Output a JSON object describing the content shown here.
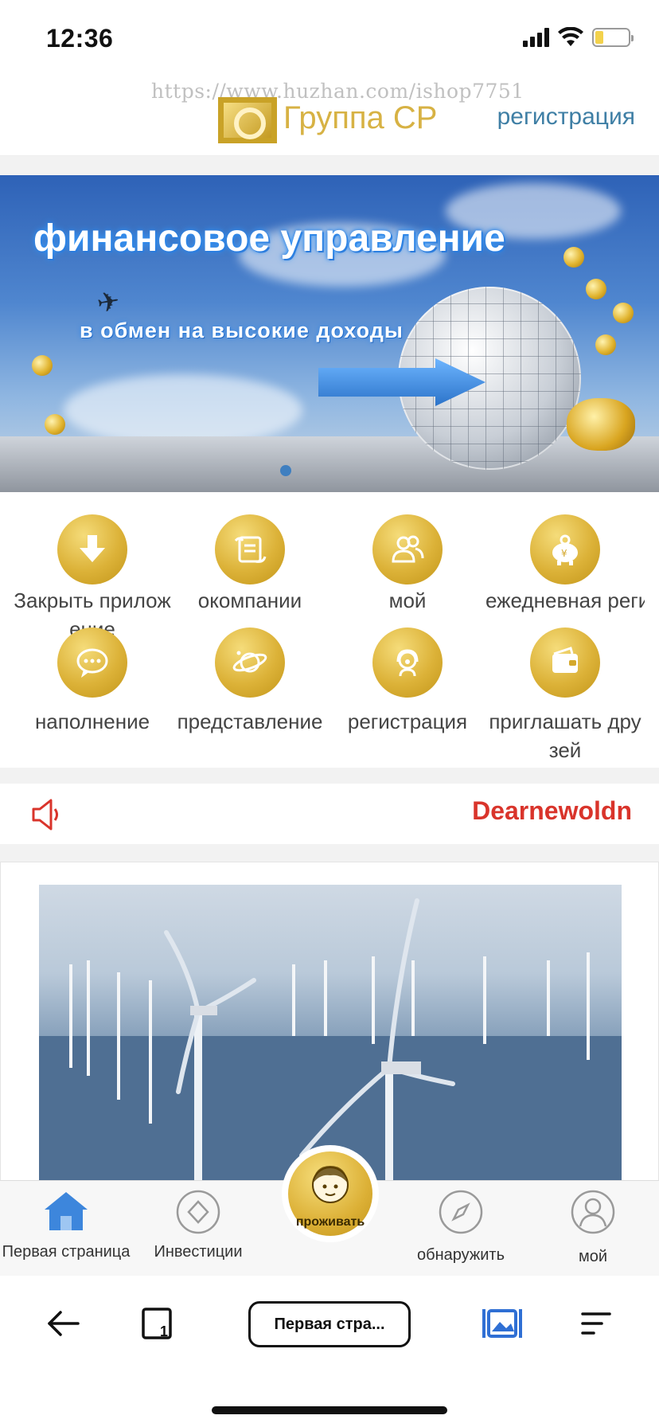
{
  "status_bar": {
    "time": "12:36",
    "battery_level": 0.25
  },
  "header": {
    "watermark": "https://www.huzhan.com/ishop7751",
    "logo_text": "Группа CP",
    "register_label": "регистрация"
  },
  "banner": {
    "title": "финансовое управление",
    "subtitle": "в обмен на высокие доходы",
    "slide_count": 1,
    "active_slide": 1
  },
  "menu": {
    "items": [
      {
        "label": "Закрыть приложение",
        "icon": "download-arrow-icon"
      },
      {
        "label": "окомпании",
        "icon": "scroll-icon"
      },
      {
        "label": "мой",
        "icon": "users-icon"
      },
      {
        "label": "ежедневная регистрация",
        "icon": "piggy-bank-icon"
      },
      {
        "label": "наполнение",
        "icon": "chat-bubble-icon"
      },
      {
        "label": "представление",
        "icon": "planet-icon"
      },
      {
        "label": "регистрация",
        "icon": "support-agent-icon"
      },
      {
        "label": "приглашать друзей",
        "icon": "wallet-icon"
      }
    ]
  },
  "notice": {
    "text": "Dearnewoldn",
    "icon": "speaker-icon"
  },
  "content": {
    "image": "offshore-wind-turbines"
  },
  "tabbar": {
    "items": [
      {
        "label": "Первая страница",
        "icon": "home-icon"
      },
      {
        "label": "Инвестиции",
        "icon": "diamond-icon"
      },
      {
        "label": "обнаружить",
        "icon": "compass-icon"
      },
      {
        "label": "мой",
        "icon": "user-icon"
      }
    ],
    "center_label": "проживать",
    "center_icon": "agent-avatar-icon"
  },
  "browser": {
    "address": "Первая стра..."
  },
  "colors": {
    "gold": "#dcb238",
    "notice_red": "#d9342b",
    "link_blue": "#3f7fa5",
    "home_blue": "#3d86dc"
  }
}
